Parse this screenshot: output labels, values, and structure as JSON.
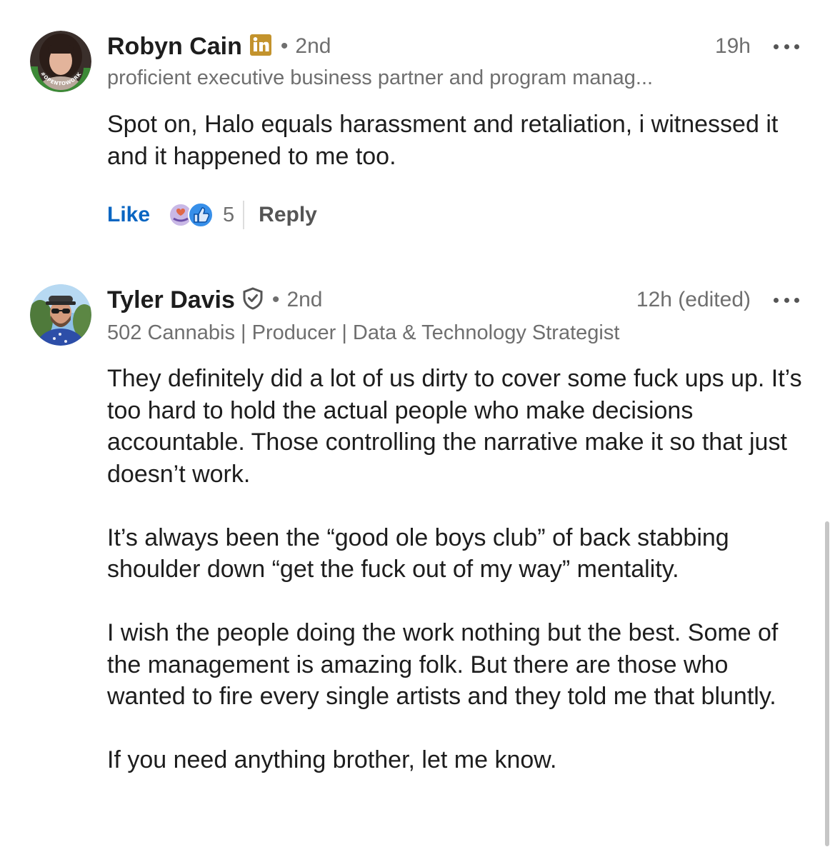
{
  "comments": [
    {
      "name": "Robyn Cain",
      "badge": "linkedin-icon",
      "degree": "2nd",
      "time": "19h",
      "headline": "proficient executive business partner and program manag...",
      "avatar_ring_text": "#OPENTOWORK",
      "body": [
        "Spot on, Halo equals harassment and retaliation, i witnessed it and it happened to me too."
      ],
      "like_label": "Like",
      "reaction_count": "5",
      "reply_label": "Reply"
    },
    {
      "name": "Tyler Davis",
      "badge": "verified-shield-icon",
      "degree": "2nd",
      "time": "12h (edited)",
      "headline": "502 Cannabis | Producer | Data & Technology Strategist",
      "body": [
        "They definitely did a lot of us dirty to cover some fuck ups up. It’s too hard to hold the actual people who make decisions accountable. Those controlling the narrative make it so that just doesn’t work.",
        "It’s always been the “good ole boys club” of back stabbing shoulder down “get the fuck out of my way” mentality.",
        "I wish the people doing the work nothing but the best. Some of the management is amazing folk. But there are those who wanted to fire every single artists and they told me that bluntly.",
        "If you need anything brother, let me know."
      ]
    }
  ],
  "separator": "•",
  "colors": {
    "link_blue": "#0a66c2",
    "secondary_text": "#6f6f6f",
    "open_to_work_green": "#3c8a37",
    "linkedin_gold": "#c3932d"
  }
}
